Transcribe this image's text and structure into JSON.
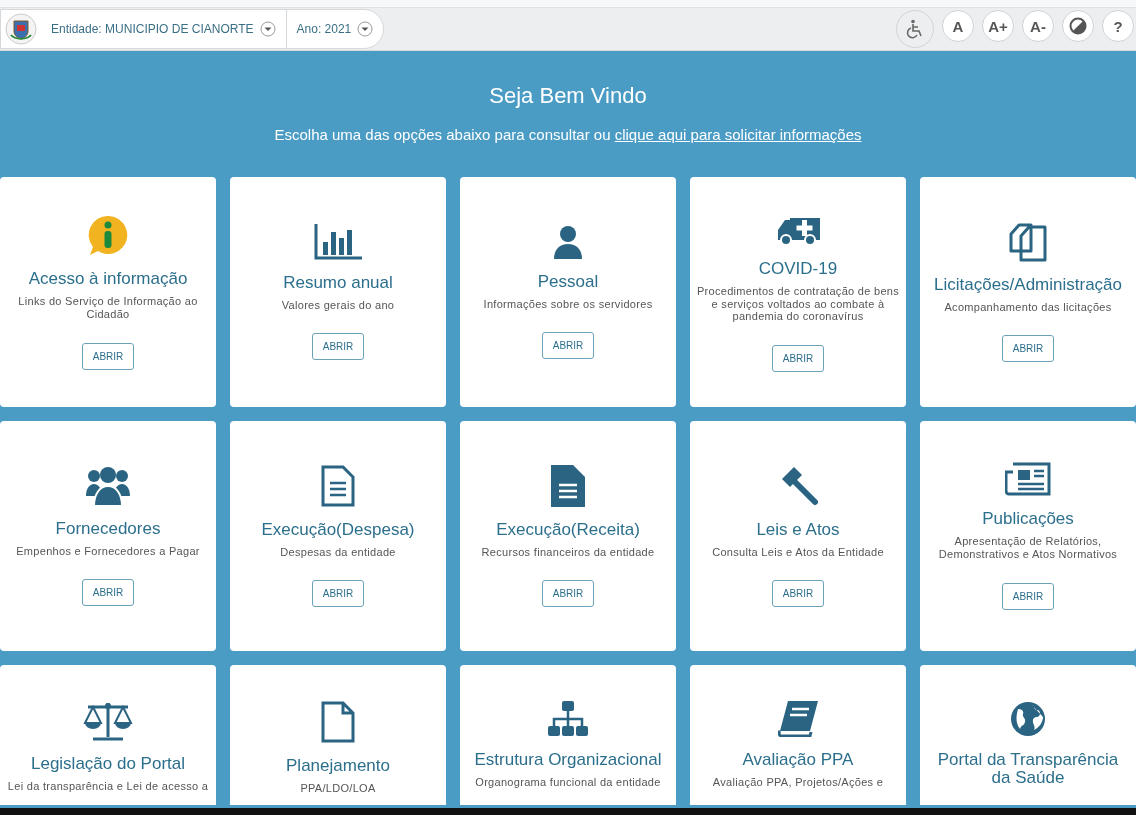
{
  "toolbar": {
    "selectors": [
      {
        "label": "Entidade:",
        "value": "MUNICIPIO DE CIANORTE"
      },
      {
        "label": "Ano:",
        "value": "2021"
      }
    ],
    "tools": [
      {
        "kind": "accessibility"
      },
      {
        "kind": "text",
        "label": "A"
      },
      {
        "kind": "text",
        "label": "A+"
      },
      {
        "kind": "text",
        "label": "A-"
      },
      {
        "kind": "contrast"
      },
      {
        "kind": "text",
        "label": "?"
      }
    ]
  },
  "welcome": {
    "title": "Seja Bem Vindo",
    "intro": "Escolha uma das opções abaixo para consultar ou",
    "link": "clique aqui para solicitar informações"
  },
  "cards": [
    {
      "title": "Acesso à informação",
      "description": "Links do Serviço de Informação ao Cidadão",
      "button": "ABRIR"
    },
    {
      "title": "Resumo anual",
      "description": "Valores gerais do ano",
      "button": "ABRIR"
    },
    {
      "title": "Pessoal",
      "description": "Informações sobre os servidores",
      "button": "ABRIR"
    },
    {
      "title": "COVID-19",
      "description": "Procedimentos de contratação de bens e serviços voltados ao combate à pandemia do coronavírus",
      "button": "ABRIR"
    },
    {
      "title": "Licitações/Administração",
      "description": "Acompanhamento das licitações",
      "button": "ABRIR"
    },
    {
      "title": "Fornecedores",
      "description": "Empenhos e Fornecedores a Pagar",
      "button": "ABRIR"
    },
    {
      "title": "Execução(Despesa)",
      "description": "Despesas da entidade",
      "button": "ABRIR"
    },
    {
      "title": "Execução(Receita)",
      "description": "Recursos financeiros da entidade",
      "button": "ABRIR"
    },
    {
      "title": "Leis e Atos",
      "description": "Consulta Leis e Atos da Entidade",
      "button": "ABRIR"
    },
    {
      "title": "Publicações",
      "description": "Apresentação de Relatórios, Demonstrativos e Atos Normativos",
      "button": "ABRIR"
    },
    {
      "title": "Legislação do Portal",
      "description": "Lei da transparência e Lei de acesso a"
    },
    {
      "title": "Planejamento",
      "description": "PPA/LDO/LOA"
    },
    {
      "title": "Estrutura Organizacional",
      "description": "Organograma funcional da entidade"
    },
    {
      "title": "Avaliação PPA",
      "description": "Avaliação PPA, Projetos/Ações e"
    },
    {
      "title": "Portal da Transparência da Saúde"
    }
  ]
}
